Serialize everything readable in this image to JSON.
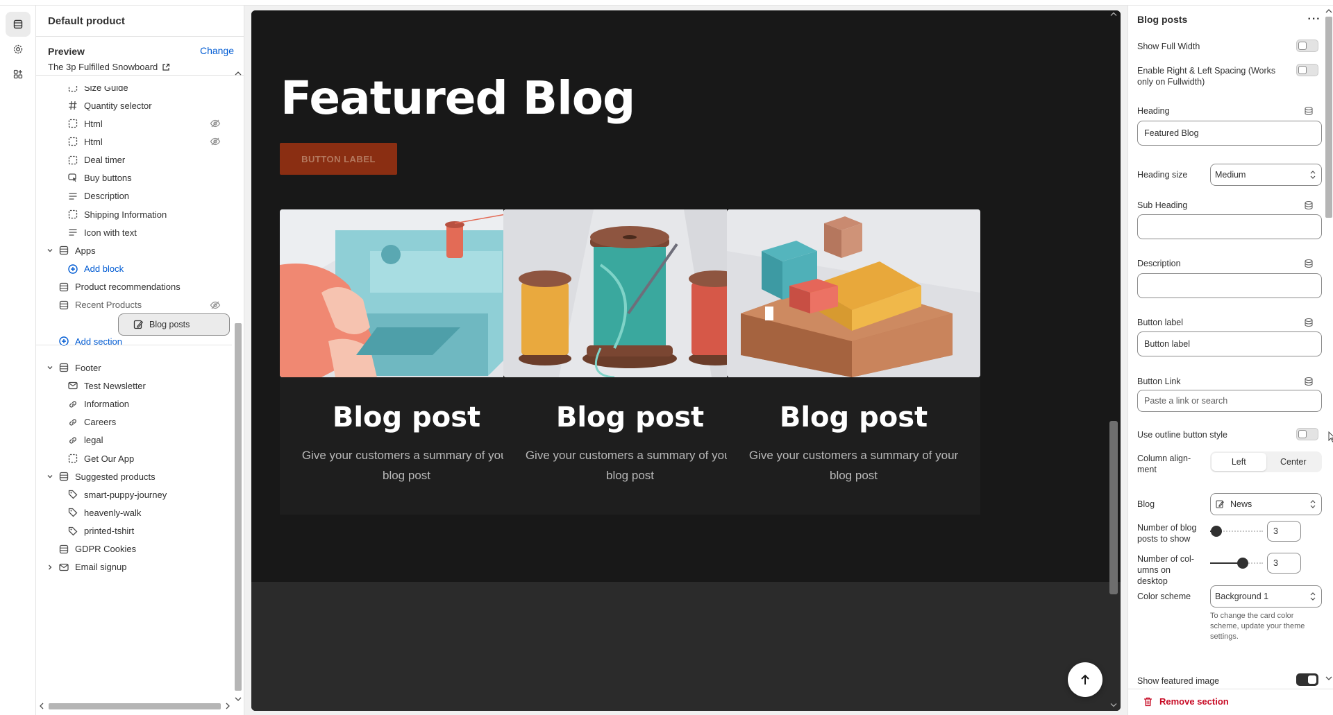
{
  "sidebar": {
    "title": "Default product",
    "preview_label": "Preview",
    "change_label": "Change",
    "preview_value": "The 3p Fulfilled Snowboard",
    "rows": [
      {
        "label": "Size Guide",
        "icon": "dashed-square-icon",
        "level": 2
      },
      {
        "label": "Quantity selector",
        "icon": "hash-icon",
        "level": 2
      },
      {
        "label": "Html",
        "icon": "dashed-square-icon",
        "level": 2,
        "hidden": true
      },
      {
        "label": "Html",
        "icon": "dashed-square-icon",
        "level": 2,
        "hidden": true
      },
      {
        "label": "Deal timer",
        "icon": "dashed-square-icon",
        "level": 2
      },
      {
        "label": "Buy buttons",
        "icon": "cursor-icon",
        "level": 2
      },
      {
        "label": "Description",
        "icon": "text-lines-icon",
        "level": 2
      },
      {
        "label": "Shipping Information",
        "icon": "dashed-square-icon",
        "level": 2
      },
      {
        "label": "Icon with text",
        "icon": "text-lines-icon",
        "level": 2
      },
      {
        "label": "Apps",
        "icon": "section-icon",
        "level": 1,
        "expanded": true
      },
      {
        "label": "Add block",
        "icon": "plus-circle-icon",
        "level": 2,
        "link": true
      },
      {
        "label": "Product recommendations",
        "icon": "section-icon",
        "level": 1
      },
      {
        "label": "Recent Products",
        "icon": "section-icon",
        "level": 1,
        "hidden": true
      },
      {
        "label": "Blog posts",
        "icon": "blog-icon",
        "level": 1,
        "selected": true
      },
      {
        "label": "Add section",
        "icon": "plus-circle-icon",
        "level": 1,
        "link": true
      },
      {
        "label": "Footer",
        "icon": "section-icon",
        "level": 1,
        "expanded": true
      },
      {
        "label": "Test Newsletter",
        "icon": "mail-icon",
        "level": 2
      },
      {
        "label": "Information",
        "icon": "link-icon",
        "level": 2
      },
      {
        "label": "Careers",
        "icon": "link-icon",
        "level": 2
      },
      {
        "label": "legal",
        "icon": "link-icon",
        "level": 2
      },
      {
        "label": "Get Our App",
        "icon": "dashed-square-icon",
        "level": 2
      },
      {
        "label": "Suggested products",
        "icon": "section-icon",
        "level": 1,
        "expanded": true
      },
      {
        "label": "smart-puppy-journey",
        "icon": "tag-icon",
        "level": 2
      },
      {
        "label": "heavenly-walk",
        "icon": "tag-icon",
        "level": 2
      },
      {
        "label": "printed-tshirt",
        "icon": "tag-icon",
        "level": 2
      },
      {
        "label": "GDPR Cookies",
        "icon": "section-icon",
        "level": 1
      },
      {
        "label": "Email signup",
        "icon": "mail-icon",
        "level": 1,
        "collapsed": true
      }
    ]
  },
  "canvas": {
    "heading": "Featured Blog",
    "button_label": "BUTTON LABEL",
    "cards": [
      {
        "title": "Blog post",
        "summary": "Give your customers a summary of your blog post",
        "image": "sewing-machine"
      },
      {
        "title": "Blog post",
        "summary": "Give your customers a summary of your blog post",
        "image": "thread-spools"
      },
      {
        "title": "Blog post",
        "summary": "Give your customers a summary of your blog post",
        "image": "boxes"
      }
    ]
  },
  "panel": {
    "title": "Blog posts",
    "show_full_width": "Show Full Width",
    "spacing": "Enable Right & Left Spacing (Works only on Fullwidth)",
    "heading_label": "Heading",
    "heading_value": "Featured Blog",
    "heading_size_label": "Heading size",
    "heading_size_value": "Medium",
    "sub_heading_label": "Sub Heading",
    "sub_heading_value": "",
    "description_label": "Description",
    "description_value": "",
    "button_label_label": "Button label",
    "button_label_value": "Button label",
    "button_link_label": "Button Link",
    "button_link_placeholder": "Paste a link or search",
    "outline_label": "Use outline button style",
    "column_align_label": "Column align-ment",
    "align_left": "Left",
    "align_center": "Center",
    "blog_label": "Blog",
    "blog_value": "News",
    "posts_label": "Number of blog posts to show",
    "posts_value": "3",
    "posts_fraction": 0.12,
    "columns_label": "Number of col-umns on desktop",
    "columns_value": "3",
    "columns_fraction": 0.62,
    "color_scheme_label": "Color scheme",
    "color_scheme_value": "Background 1",
    "color_hint": "To change the card color scheme, update your theme settings.",
    "featured_image_label": "Show featured image",
    "remove_label": "Remove section"
  },
  "colors": {
    "accent": "#005bd3",
    "danger": "#c70a24",
    "canvas_bg": "#181818",
    "cta": "#8a2e12"
  }
}
